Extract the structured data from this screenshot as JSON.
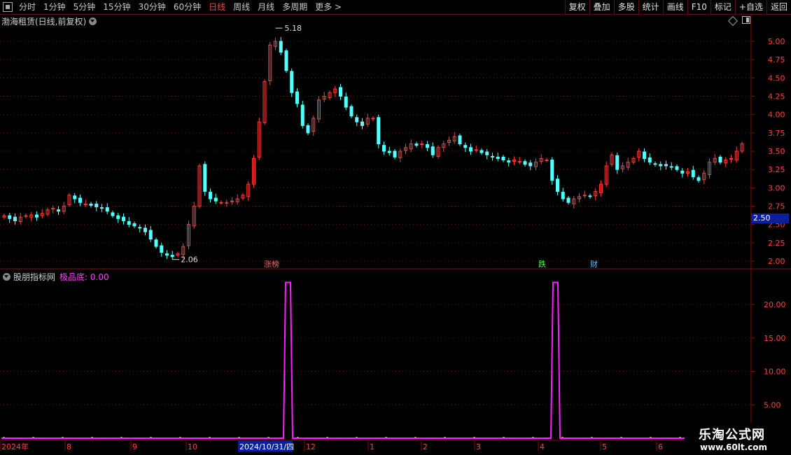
{
  "toolbar": {
    "left_items": [
      {
        "label": "分时"
      },
      {
        "label": "1分钟"
      },
      {
        "label": "5分钟"
      },
      {
        "label": "15分钟"
      },
      {
        "label": "30分钟"
      },
      {
        "label": "60分钟"
      },
      {
        "label": "日线"
      },
      {
        "label": "周线"
      },
      {
        "label": "月线"
      },
      {
        "label": "多周期"
      },
      {
        "label": "更多 >"
      }
    ],
    "right_items": [
      {
        "label": "复权"
      },
      {
        "label": "叠加"
      },
      {
        "label": "多股"
      },
      {
        "label": "统计"
      },
      {
        "label": "画线"
      },
      {
        "label": "F10"
      },
      {
        "label": "标记"
      },
      {
        "label": "+自选"
      },
      {
        "label": "返回"
      }
    ]
  },
  "main_chart": {
    "title": "渤海租赁(日线,前复权)",
    "high_label": "5.18",
    "low_label": "2.06",
    "current_price": "2.50",
    "y_ticks": [
      "5.00",
      "4.75",
      "4.50",
      "4.25",
      "4.00",
      "3.75",
      "3.50",
      "3.25",
      "3.00",
      "2.75",
      "2.50",
      "2.25",
      "2.00"
    ],
    "event_markers": [
      {
        "label": "涨榜",
        "color": "#ff6060"
      },
      {
        "label": "跌",
        "color": "#40ff40"
      },
      {
        "label": "财",
        "color": "#60c0ff"
      }
    ]
  },
  "indicator": {
    "name": "股朋指标网",
    "param": "极品底: 0.00",
    "y_ticks": [
      "20.00",
      "15.00",
      "10.00",
      "5.00"
    ]
  },
  "date_axis": {
    "labels": [
      "2024年",
      "8",
      "9",
      "10",
      "2024/10/31/四",
      "12",
      "1",
      "2",
      "3",
      "4",
      "5",
      "6"
    ]
  },
  "watermark": {
    "line1": "乐淘公式网",
    "line2": "www.60lt.com"
  },
  "colors": {
    "up": "#ff3c3c",
    "down": "#54ffff",
    "grid": "#7a1010",
    "indicator_line": "#ff20ff"
  },
  "chart_data": [
    {
      "type": "candlestick",
      "title": "渤海租赁(日线,前复权)",
      "ylim": [
        1.95,
        5.25
      ],
      "note_high": 5.18,
      "note_low": 2.06,
      "x_labels": [
        "2024年",
        "8",
        "9",
        "10",
        "2024/10/31/四",
        "12",
        "1",
        "2",
        "3",
        "4",
        "5",
        "6"
      ],
      "close_series": [
        2.62,
        2.58,
        2.55,
        2.6,
        2.62,
        2.63,
        2.6,
        2.65,
        2.7,
        2.72,
        2.68,
        2.75,
        2.9,
        2.85,
        2.8,
        2.78,
        2.76,
        2.74,
        2.72,
        2.68,
        2.62,
        2.58,
        2.55,
        2.5,
        2.48,
        2.45,
        2.4,
        2.3,
        2.2,
        2.12,
        2.08,
        2.06,
        2.1,
        2.2,
        2.5,
        2.75,
        3.3,
        2.95,
        2.85,
        2.82,
        2.8,
        2.8,
        2.82,
        2.85,
        2.9,
        3.05,
        3.4,
        3.9,
        4.45,
        4.95,
        5.0,
        4.85,
        4.6,
        4.3,
        4.15,
        3.85,
        3.75,
        3.95,
        4.2,
        4.25,
        4.3,
        4.35,
        4.25,
        4.1,
        3.98,
        3.9,
        3.85,
        3.95,
        3.95,
        3.6,
        3.5,
        3.48,
        3.42,
        3.5,
        3.55,
        3.6,
        3.58,
        3.6,
        3.55,
        3.45,
        3.55,
        3.6,
        3.65,
        3.7,
        3.6,
        3.55,
        3.5,
        3.52,
        3.48,
        3.45,
        3.42,
        3.4,
        3.38,
        3.35,
        3.38,
        3.36,
        3.32,
        3.3,
        3.35,
        3.4,
        3.38,
        3.1,
        2.95,
        2.85,
        2.8,
        2.85,
        2.88,
        2.9,
        2.88,
        2.95,
        3.05,
        3.3,
        3.45,
        3.25,
        3.3,
        3.35,
        3.4,
        3.5,
        3.4,
        3.35,
        3.32,
        3.3,
        3.3,
        3.28,
        3.25,
        3.2,
        3.22,
        3.15,
        3.1,
        3.2,
        3.35,
        3.4,
        3.35,
        3.38,
        3.4,
        3.5,
        3.6
      ]
    },
    {
      "type": "line",
      "name": "极品底",
      "ylim": [
        0,
        24
      ],
      "peaks": [
        {
          "x_label": "2024/10/31/四",
          "value": 23.3
        },
        {
          "x_label": "4",
          "value": 23.3
        }
      ],
      "baseline": 0.0
    }
  ]
}
